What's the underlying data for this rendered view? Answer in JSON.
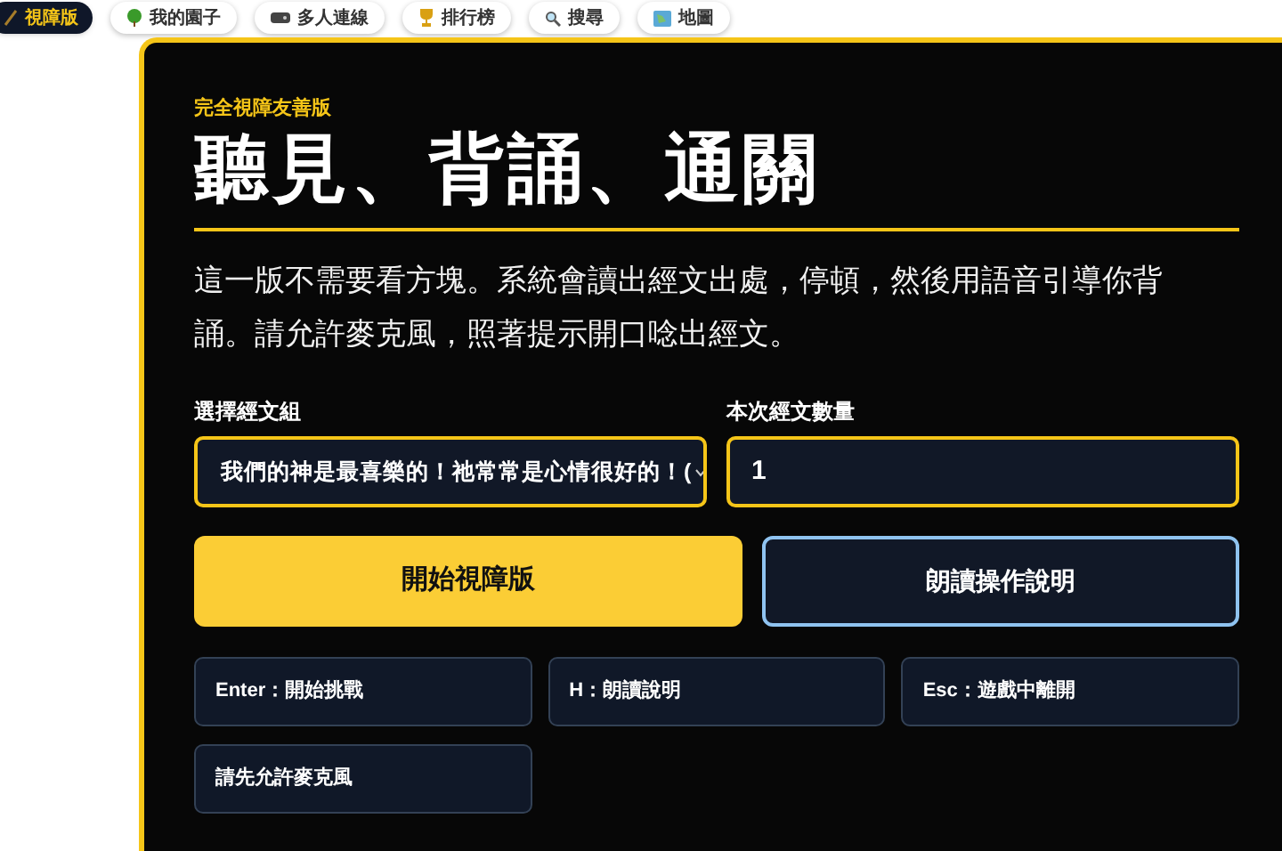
{
  "nav": [
    {
      "label": "視障版",
      "selected": true
    },
    {
      "label": "我的園子",
      "selected": false
    },
    {
      "label": "多人連線",
      "selected": false
    },
    {
      "label": "排行榜",
      "selected": false
    },
    {
      "label": "搜尋",
      "selected": false
    },
    {
      "label": "地圖",
      "selected": false
    }
  ],
  "panel": {
    "eyebrow": "完全視障友善版",
    "title": "聽見、背誦、通關",
    "description": "這一版不需要看方塊。系統會讀出經文出處，停頓，然後用語音引導你背誦。請允許麥克風，照著提示開口唸出經文。",
    "group_select": {
      "label": "選擇經文組",
      "value": "我們的神是最喜樂的！祂常常是心情很好的！("
    },
    "count_field": {
      "label": "本次經文數量",
      "value": "1"
    },
    "buttons": [
      {
        "label": "開始視障版",
        "kind": "primary"
      },
      {
        "label": "朗讀操作說明",
        "kind": "secondary"
      }
    ],
    "hints": [
      "Enter：開始挑戰",
      "H：朗讀說明",
      "Esc：遊戲中離開",
      "請先允許麥克風"
    ]
  }
}
